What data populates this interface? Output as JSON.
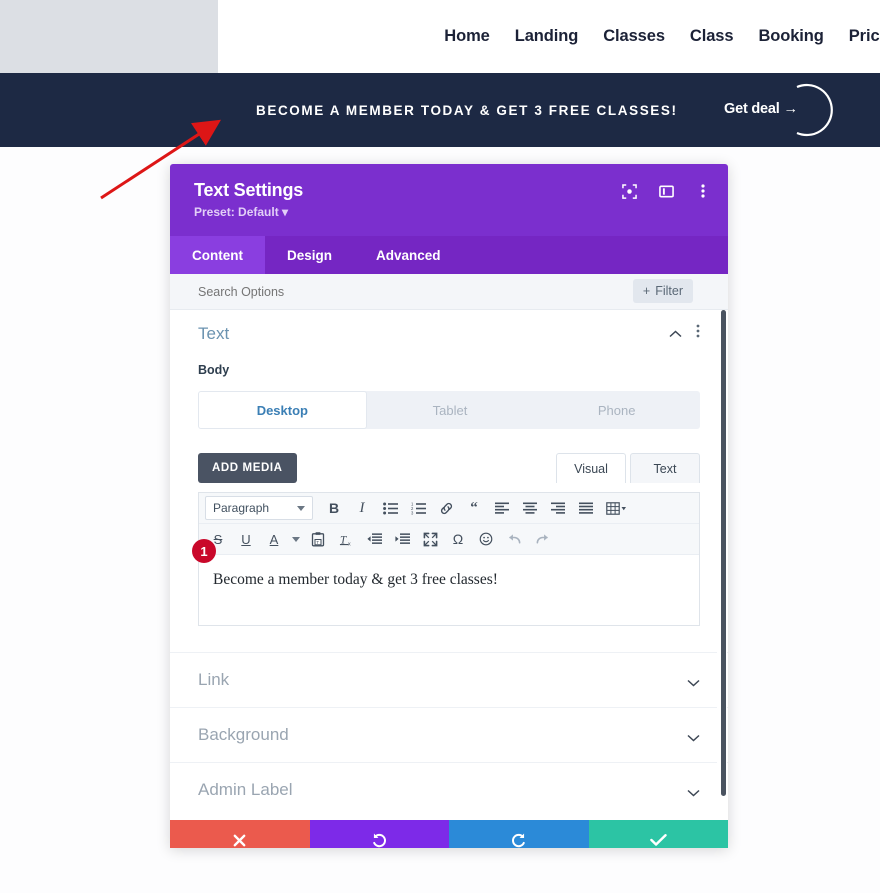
{
  "site": {
    "nav_items": [
      {
        "label": "Home"
      },
      {
        "label": "Landing"
      },
      {
        "label": "Classes"
      },
      {
        "label": "Class"
      },
      {
        "label": "Booking"
      },
      {
        "label": "Pricin"
      }
    ],
    "promo": {
      "text": "BECOME A MEMBER TODAY & GET 3 FREE CLASSES!",
      "cta_label": "Get deal →",
      "background_color": "#1d2944"
    }
  },
  "modal": {
    "title": "Text Settings",
    "preset": "Preset: Default ▾",
    "header_color": "#7b2fce",
    "header_icons": [
      {
        "name": "focus-icon"
      },
      {
        "name": "split-view-icon"
      },
      {
        "name": "more-options-icon"
      }
    ],
    "tabs": [
      {
        "label": "Content",
        "active": true
      },
      {
        "label": "Design",
        "active": false
      },
      {
        "label": "Advanced",
        "active": false
      }
    ],
    "search": {
      "placeholder": "Search Options",
      "value": "",
      "filter_label": "Filter",
      "filter_icon": "plus-icon"
    },
    "text_section": {
      "title": "Text",
      "collapse_icon": "chevron-up-icon",
      "more_icon": "more-options-icon",
      "body_label": "Body",
      "device_tabs": [
        {
          "label": "Desktop",
          "active": true
        },
        {
          "label": "Tablet",
          "active": false
        },
        {
          "label": "Phone",
          "active": false
        }
      ],
      "add_media_label": "ADD MEDIA",
      "view_tabs": [
        {
          "label": "Visual",
          "active": true
        },
        {
          "label": "Text",
          "active": false
        }
      ],
      "format_select_value": "Paragraph",
      "toolbar_row1": [
        {
          "name": "bold-icon",
          "glyph": "B"
        },
        {
          "name": "italic-icon",
          "glyph": "I"
        },
        {
          "name": "bulleted-list-icon",
          "glyph": ""
        },
        {
          "name": "numbered-list-icon",
          "glyph": ""
        },
        {
          "name": "link-icon",
          "glyph": ""
        },
        {
          "name": "blockquote-icon",
          "glyph": "“"
        },
        {
          "name": "align-left-icon",
          "glyph": ""
        },
        {
          "name": "align-center-icon",
          "glyph": ""
        },
        {
          "name": "align-right-icon",
          "glyph": ""
        },
        {
          "name": "align-justify-icon",
          "glyph": ""
        },
        {
          "name": "table-icon",
          "glyph": ""
        }
      ],
      "toolbar_row2": [
        {
          "name": "strikethrough-icon",
          "glyph": "S"
        },
        {
          "name": "underline-icon",
          "glyph": "U"
        },
        {
          "name": "text-color-icon",
          "glyph": "A"
        },
        {
          "name": "text-color-dropdown-icon",
          "glyph": "▾"
        },
        {
          "name": "paste-as-text-icon",
          "glyph": ""
        },
        {
          "name": "clear-formatting-icon",
          "glyph": ""
        },
        {
          "name": "outdent-icon",
          "glyph": ""
        },
        {
          "name": "indent-icon",
          "glyph": ""
        },
        {
          "name": "fullscreen-icon",
          "glyph": ""
        },
        {
          "name": "special-character-icon",
          "glyph": "Ω"
        },
        {
          "name": "emoji-icon",
          "glyph": "☺"
        },
        {
          "name": "undo-icon",
          "glyph": ""
        },
        {
          "name": "redo-icon",
          "glyph": ""
        }
      ],
      "editor_content": "Become a member today & get 3 free classes!",
      "step_badge": "1"
    },
    "collapsed_sections": [
      {
        "label": "Link",
        "icon": "chevron-down-icon"
      },
      {
        "label": "Background",
        "icon": "chevron-down-icon"
      },
      {
        "label": "Admin Label",
        "icon": "chevron-down-icon"
      }
    ],
    "actions": [
      {
        "name": "cancel-button",
        "icon": "close-icon",
        "color": "#eb5a4d"
      },
      {
        "name": "undo-button",
        "icon": "undo-icon",
        "color": "#7d2ae8"
      },
      {
        "name": "redo-button",
        "icon": "redo-icon",
        "color": "#2b8ad8"
      },
      {
        "name": "save-button",
        "icon": "check-icon",
        "color": "#2cc4a4"
      }
    ]
  }
}
